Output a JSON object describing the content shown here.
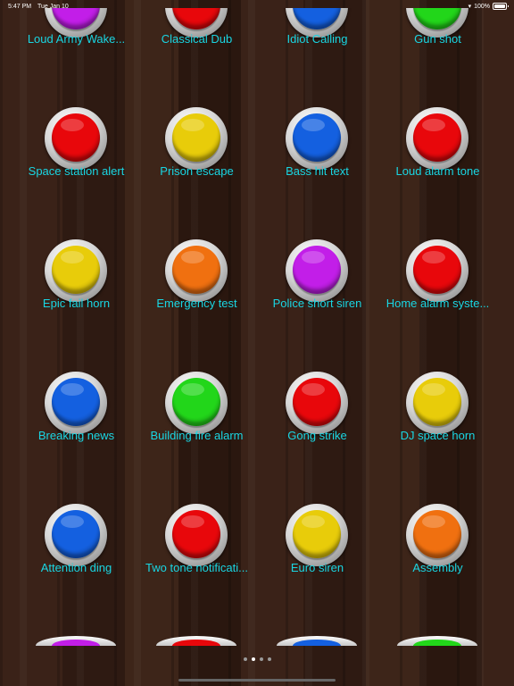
{
  "status_bar": {
    "time": "5:47 PM",
    "date": "Tue Jan 10",
    "battery": "100%",
    "icons": [
      "wifi-icon",
      "battery-icon"
    ]
  },
  "colors": {
    "purple": "#c21ee8",
    "red": "#e8070b",
    "blue": "#1460e0",
    "green": "#22d61a",
    "yellow": "#e8cc0a",
    "orange": "#f07010",
    "label": "#19d6e3"
  },
  "sounds": [
    {
      "label": "Loud Army Wake...",
      "color": "purple"
    },
    {
      "label": "Classical Dub",
      "color": "red"
    },
    {
      "label": "Idiot Calling",
      "color": "blue"
    },
    {
      "label": "Gun shot",
      "color": "green"
    },
    {
      "label": "Space station alert",
      "color": "red"
    },
    {
      "label": "Prison escape",
      "color": "yellow"
    },
    {
      "label": "Bass hit text",
      "color": "blue"
    },
    {
      "label": "Loud alarm tone",
      "color": "red"
    },
    {
      "label": "Epic fail horn",
      "color": "yellow"
    },
    {
      "label": "Emergency test",
      "color": "orange"
    },
    {
      "label": "Police short siren",
      "color": "purple"
    },
    {
      "label": "Home alarm syste...",
      "color": "red"
    },
    {
      "label": "Breaking news",
      "color": "blue"
    },
    {
      "label": "Building fire alarm",
      "color": "green"
    },
    {
      "label": "Gong strike",
      "color": "red"
    },
    {
      "label": "DJ space horn",
      "color": "yellow"
    },
    {
      "label": "Attention ding",
      "color": "blue"
    },
    {
      "label": "Two tone notificati...",
      "color": "red"
    },
    {
      "label": "Euro siren",
      "color": "yellow"
    },
    {
      "label": "Assembly",
      "color": "orange"
    },
    {
      "label": "",
      "color": "purple"
    },
    {
      "label": "",
      "color": "red"
    },
    {
      "label": "",
      "color": "blue"
    },
    {
      "label": "",
      "color": "green"
    }
  ],
  "pagination": {
    "pages": 4,
    "current": 2
  }
}
